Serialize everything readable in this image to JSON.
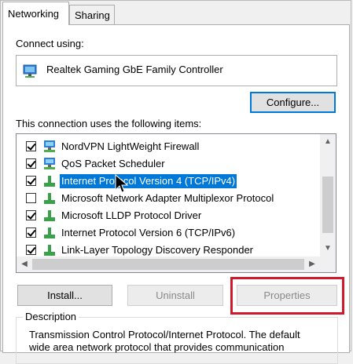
{
  "tabs": [
    {
      "label": "Networking",
      "active": true
    },
    {
      "label": "Sharing",
      "active": false
    }
  ],
  "connect_using": {
    "label": "Connect using:",
    "adapter": "Realtek Gaming GbE Family Controller",
    "adapter_icon": "network-adapter-icon"
  },
  "buttons": {
    "configure": "Configure...",
    "install": "Install...",
    "uninstall": "Uninstall",
    "properties": "Properties"
  },
  "items_label": "This connection uses the following items:",
  "items": [
    {
      "label": "NordVPN LightWeight Firewall",
      "checked": true,
      "icon": "network-service-icon",
      "selected": false
    },
    {
      "label": "QoS Packet Scheduler",
      "checked": true,
      "icon": "network-service-icon",
      "selected": false
    },
    {
      "label": "Internet Protocol Version 4 (TCP/IPv4)",
      "checked": true,
      "icon": "protocol-icon",
      "selected": true
    },
    {
      "label": "Microsoft Network Adapter Multiplexor Protocol",
      "checked": false,
      "icon": "protocol-icon",
      "selected": false
    },
    {
      "label": "Microsoft LLDP Protocol Driver",
      "checked": true,
      "icon": "protocol-icon",
      "selected": false
    },
    {
      "label": "Internet Protocol Version 6 (TCP/IPv6)",
      "checked": true,
      "icon": "protocol-icon",
      "selected": false
    },
    {
      "label": "Link-Layer Topology Discovery Responder",
      "checked": true,
      "icon": "protocol-icon",
      "selected": false
    }
  ],
  "description": {
    "title": "Description",
    "line1": "Transmission Control Protocol/Internet Protocol. The default",
    "line2": "wide area network protocol that provides communication"
  },
  "colors": {
    "selection": "#0078d7",
    "highlight_box": "#d01a2b"
  }
}
